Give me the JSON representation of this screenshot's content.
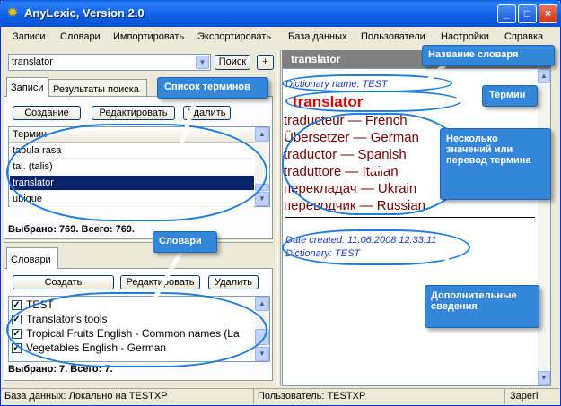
{
  "window": {
    "title": "AnyLexic, Version 2.0",
    "min": "_",
    "max": "□",
    "close": "×"
  },
  "menu": [
    "Записи",
    "Словари",
    "Импортировать",
    "Экспортировать",
    "База данных",
    "Пользователи",
    "Настройки",
    "Справка"
  ],
  "search": {
    "value": "translator",
    "button": "Поиск",
    "plus": "+"
  },
  "records_tabs": [
    "Записи",
    "Результаты поиска"
  ],
  "records_buttons": [
    "Создание",
    "Редактировать",
    "Удалить"
  ],
  "terms": {
    "header": "Термин",
    "rows": [
      "tabula rasa",
      "tal. (talis)",
      "translator",
      "ubique"
    ],
    "selected": "translator",
    "count": "Выбрано: 769. Всего: 769."
  },
  "dicts_tab": "Словари",
  "dict_buttons": [
    "Создать",
    "Редактировать",
    "Удалить"
  ],
  "dictionaries": {
    "items": [
      "TEST",
      "Translator's tools",
      "Tropical Fruits English - Common names (La",
      "Vegetables English - German"
    ],
    "count": "Выбрано: 7. Всего: 7."
  },
  "entry": {
    "header": "translator",
    "dict_name": "Dictionary name: TEST",
    "term": "translator",
    "translations": [
      "traducteur — French",
      "Übersetzer — German",
      "traductor — Spanish",
      "traduttore — Italian",
      "перекладач — Ukrain",
      "переводчик — Russian"
    ],
    "date_created": "Date created: 11.06.2008 12:33:11",
    "dictionary": "Dictionary: TEST"
  },
  "callouts": {
    "terms_list": "Список терминов",
    "dicts": "Словари",
    "dict_name": "Название словаря",
    "term": "Термин",
    "values": "Несколько значений или перевод термина",
    "extra": "Дополнительные сведения"
  },
  "status": {
    "db": "База данных: Локально на TESTXP",
    "user": "Пользователь: TESTXP",
    "reg": "Зарегі"
  },
  "colors": {
    "accent": "#3486d9",
    "translation": "#7a0000",
    "term": "#e00000",
    "meta": "#1e3cc8"
  }
}
